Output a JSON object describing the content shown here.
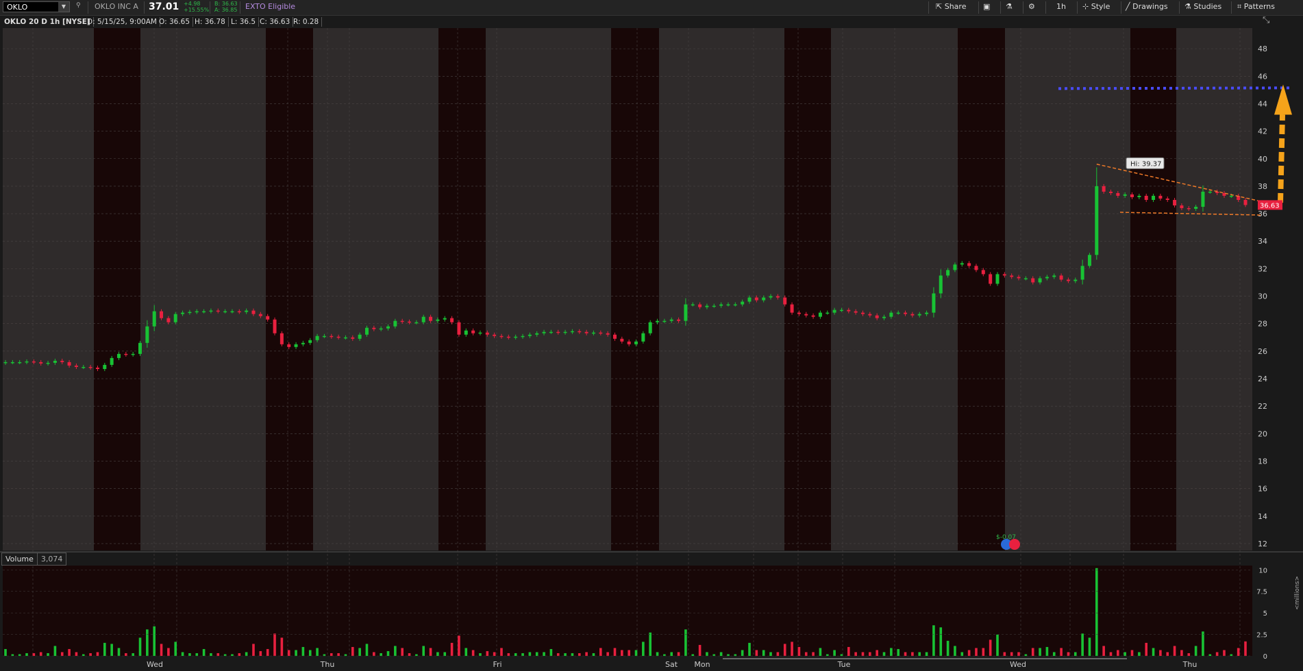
{
  "topbar": {
    "symbol": "OKLO",
    "company": "OKLO INC A",
    "last": "37.01",
    "change": "+4.98",
    "change_pct": "+15.55%",
    "bid": "B: 36.63",
    "ask": "A: 36.85",
    "exto": "EXTO Eligible",
    "share": "Share",
    "interval": "1h",
    "style": "Style",
    "drawings": "Drawings",
    "studies": "Studies",
    "patterns": "Patterns"
  },
  "infobar": {
    "title": "OKLO 20 D 1h [NYSE]",
    "date": "D: 5/15/25, 9:00AM",
    "open": "O: 36.65",
    "high": "H: 36.78",
    "low": "L: 36.5",
    "close": "C: 36.63",
    "range": "R: 0.28"
  },
  "volume": {
    "label": "Volume",
    "value": "3,074",
    "unit": "<millions>"
  },
  "annotations": {
    "hi_label": "Hi: 39.37",
    "last_price": "36.63",
    "earnings": "$-0.07"
  },
  "colors": {
    "up": "#18c234",
    "down": "#e8203f",
    "session_off": "#180707",
    "session_on": "#2f2b2b"
  },
  "chart_data": {
    "type": "candlestick",
    "price_axis": {
      "ylim": [
        11.5,
        49.5
      ],
      "ticks": [
        12,
        14,
        16,
        18,
        20,
        22,
        24,
        26,
        28,
        30,
        32,
        34,
        36,
        38,
        40,
        42,
        44,
        46,
        48
      ]
    },
    "volume_axis": {
      "ylim": [
        0,
        10.5
      ],
      "ticks": [
        "10",
        "7.5",
        "5",
        "2.5",
        "0"
      ]
    },
    "x_labels": [
      "Wed",
      "Thu",
      "Fri",
      "Sat",
      "Mon",
      "Tue",
      "Wed",
      "Thu"
    ],
    "close": [
      25.2,
      25.2,
      25.2,
      25.25,
      25.2,
      25.1,
      25.15,
      25.3,
      25.2,
      24.95,
      24.85,
      24.85,
      24.8,
      24.7,
      25.0,
      25.5,
      25.8,
      25.75,
      25.8,
      26.6,
      27.8,
      28.9,
      28.4,
      28.1,
      28.7,
      28.8,
      28.85,
      28.9,
      28.9,
      28.95,
      28.9,
      28.9,
      28.9,
      28.85,
      28.95,
      28.7,
      28.55,
      28.3,
      27.3,
      26.5,
      26.3,
      26.5,
      26.6,
      26.8,
      27.1,
      27.1,
      27.05,
      27.0,
      27.0,
      26.9,
      27.2,
      27.7,
      27.6,
      27.65,
      27.8,
      28.2,
      28.15,
      28.1,
      28.1,
      28.5,
      28.2,
      28.3,
      28.4,
      28.1,
      27.2,
      27.5,
      27.3,
      27.35,
      27.2,
      27.1,
      27.05,
      27.0,
      27.05,
      27.1,
      27.2,
      27.3,
      27.4,
      27.4,
      27.35,
      27.4,
      27.45,
      27.4,
      27.3,
      27.35,
      27.3,
      27.2,
      26.9,
      26.7,
      26.5,
      26.7,
      27.3,
      28.1,
      28.2,
      28.2,
      28.3,
      28.2,
      29.4,
      29.4,
      29.2,
      29.3,
      29.3,
      29.4,
      29.4,
      29.4,
      29.6,
      29.9,
      29.7,
      29.9,
      30.0,
      29.9,
      29.4,
      28.8,
      28.7,
      28.6,
      28.5,
      28.8,
      28.8,
      29.0,
      29.0,
      28.9,
      28.8,
      28.7,
      28.6,
      28.4,
      28.5,
      28.8,
      28.8,
      28.7,
      28.6,
      28.7,
      28.8,
      30.2,
      31.5,
      31.9,
      32.3,
      32.4,
      32.2,
      31.9,
      31.6,
      30.9,
      31.6,
      31.5,
      31.4,
      31.3,
      31.3,
      31.0,
      31.3,
      31.4,
      31.5,
      31.2,
      31.1,
      31.2,
      32.2,
      33.0,
      38.0,
      37.6,
      37.5,
      37.3,
      37.4,
      37.2,
      37.3,
      37.0,
      37.3,
      37.1,
      37.0,
      36.6,
      36.4,
      36.35,
      36.5,
      37.6,
      37.6,
      37.5,
      37.3,
      37.3,
      37.0,
      36.63
    ],
    "hi_marker": 39.37,
    "last_price": 36.63,
    "resistance_level": 45.1
  }
}
